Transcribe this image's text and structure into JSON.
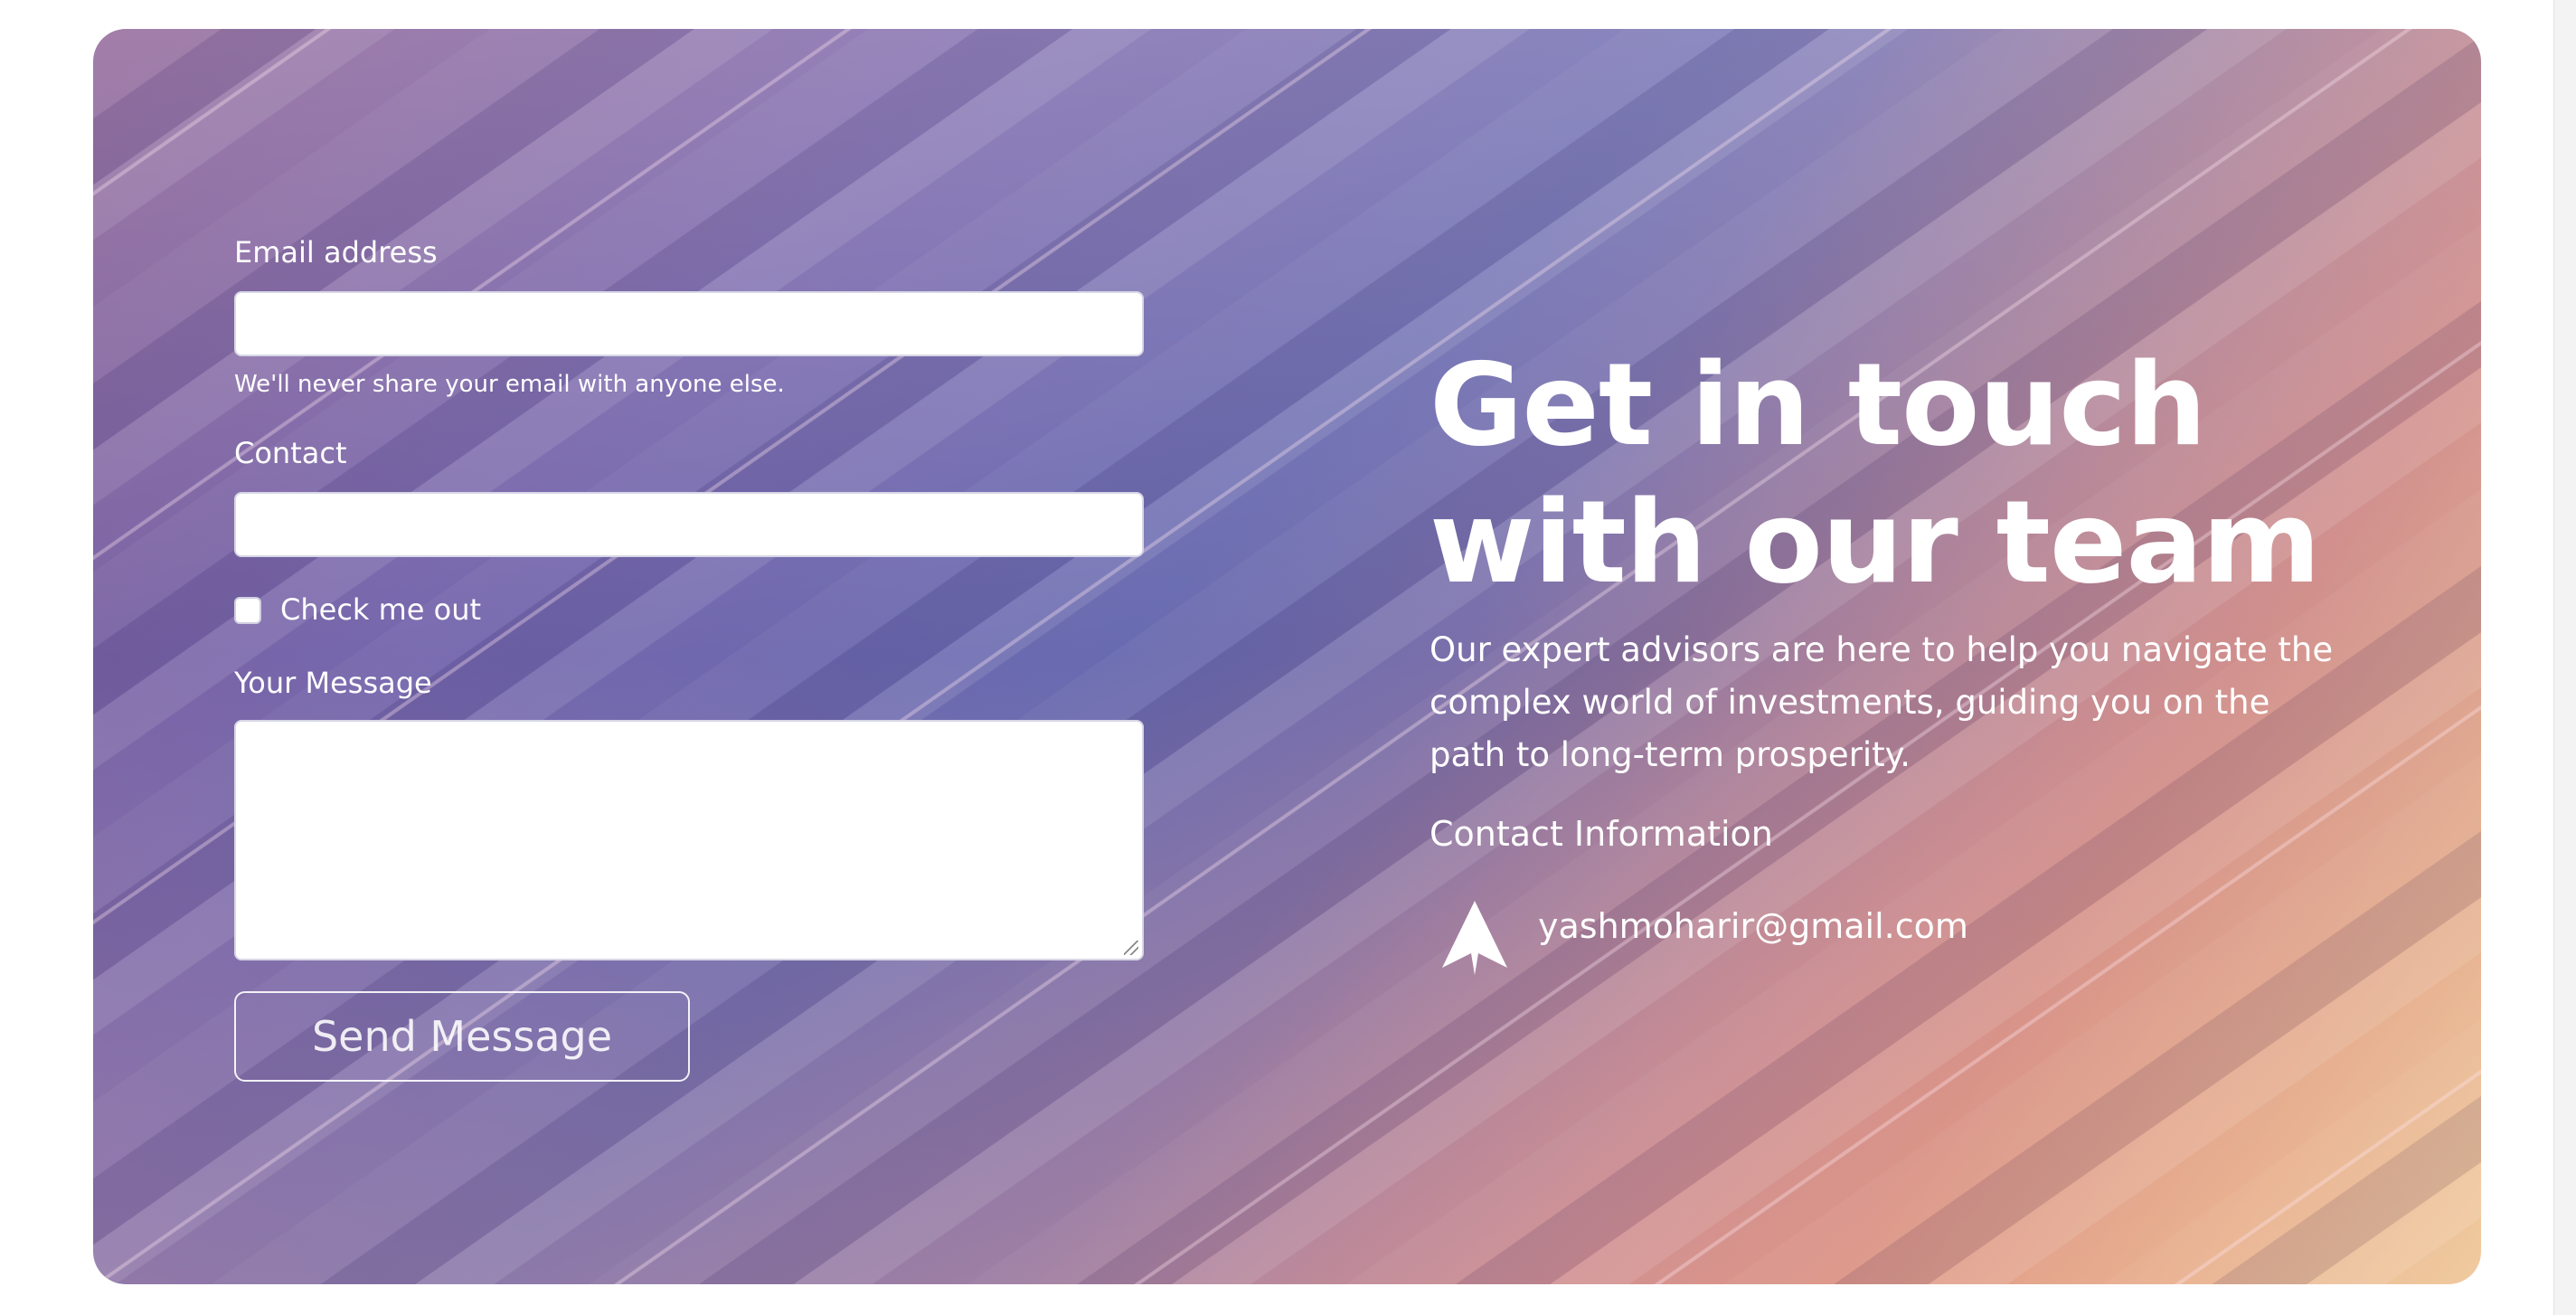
{
  "form": {
    "email_label": "Email address",
    "email_value": "",
    "email_help": "We'll never share your email with anyone else.",
    "contact_label": "Contact",
    "contact_value": "",
    "checkbox_label": "Check me out",
    "checkbox_checked": false,
    "message_label": "Your Message",
    "message_value": "",
    "submit_label": "Send Message"
  },
  "info": {
    "headline_line1": "Get in touch",
    "headline_line2": "with our team",
    "description": "Our expert advisors are here to help you navigate the complex world of investments, guiding you on the path to long-term prosperity.",
    "contact_heading": "Contact Information",
    "email": "yashmoharir@gmail.com",
    "email_icon": "send-paper-plane-icon"
  },
  "colors": {
    "text": "#ffffff",
    "input_background": "#ffffff",
    "button_border": "#ffffff"
  }
}
